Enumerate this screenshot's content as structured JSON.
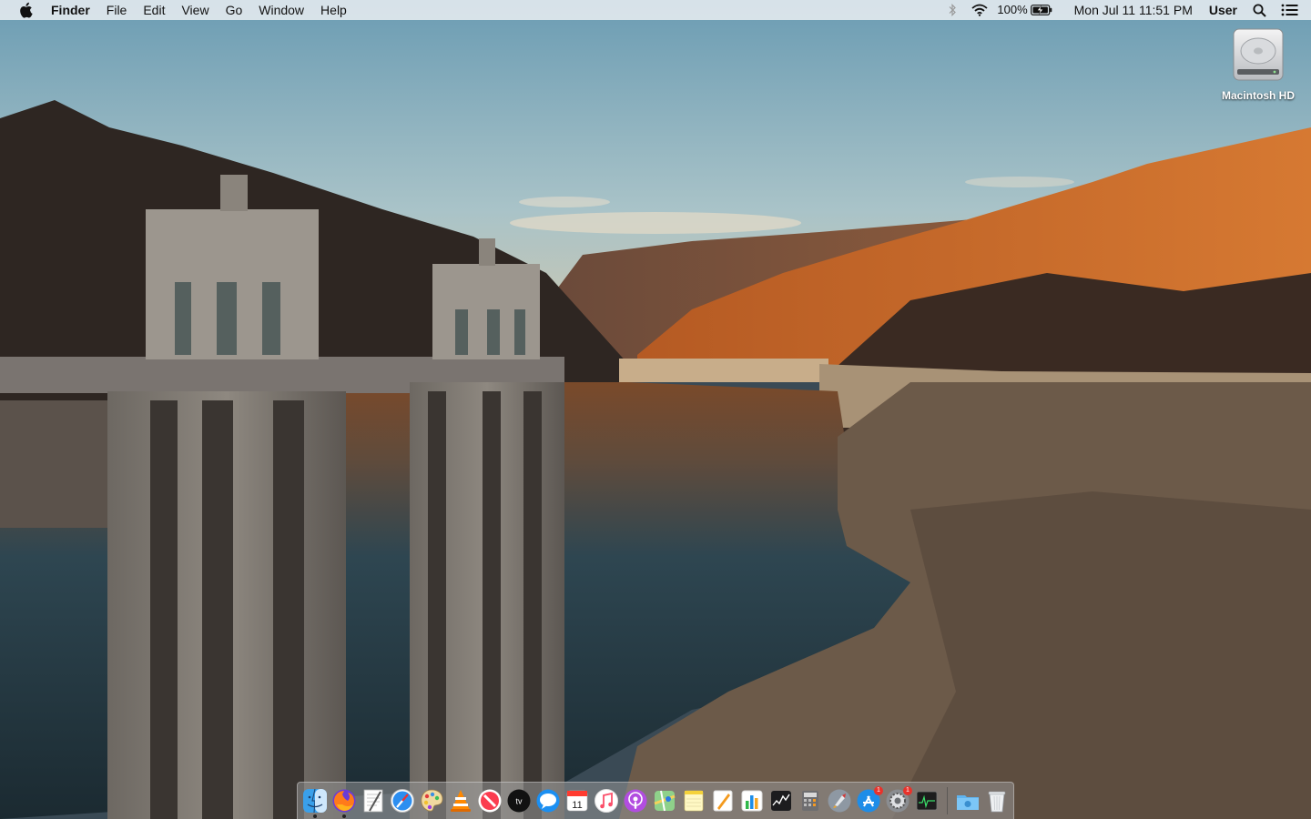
{
  "menubar": {
    "app_name": "Finder",
    "menus": [
      "File",
      "Edit",
      "View",
      "Go",
      "Window",
      "Help"
    ],
    "battery_percent": "100%",
    "clock": "Mon Jul 11  11:51 PM",
    "user": "User"
  },
  "desktop": {
    "icons": [
      {
        "label": "Macintosh HD",
        "icon": "hard-drive-icon"
      }
    ]
  },
  "dock": {
    "apps": [
      {
        "name": "finder",
        "icon": "finder-icon",
        "running": true
      },
      {
        "name": "firefox",
        "icon": "firefox-icon",
        "running": true
      },
      {
        "name": "textedit",
        "icon": "textedit-icon"
      },
      {
        "name": "safari",
        "icon": "safari-icon"
      },
      {
        "name": "color-picker",
        "icon": "palette-icon"
      },
      {
        "name": "vlc",
        "icon": "vlc-icon"
      },
      {
        "name": "news",
        "icon": "news-icon"
      },
      {
        "name": "apple-tv",
        "icon": "tv-icon",
        "label": "tv"
      },
      {
        "name": "messages",
        "icon": "messages-icon"
      },
      {
        "name": "calendar",
        "icon": "calendar-icon",
        "label": "11"
      },
      {
        "name": "music",
        "icon": "music-icon"
      },
      {
        "name": "podcasts",
        "icon": "podcasts-icon"
      },
      {
        "name": "maps",
        "icon": "maps-icon"
      },
      {
        "name": "notes",
        "icon": "notes-icon"
      },
      {
        "name": "pages",
        "icon": "pages-icon"
      },
      {
        "name": "numbers",
        "icon": "numbers-icon"
      },
      {
        "name": "stocks",
        "icon": "stocks-icon"
      },
      {
        "name": "calculator",
        "icon": "calculator-icon"
      },
      {
        "name": "launchpad",
        "icon": "launchpad-icon"
      },
      {
        "name": "app-store",
        "icon": "app-store-icon",
        "badge": "1"
      },
      {
        "name": "system-preferences",
        "icon": "gear-icon",
        "badge": "1"
      },
      {
        "name": "activity-monitor",
        "icon": "terminal-icon"
      },
      {
        "name": "downloads",
        "icon": "folder-icon"
      },
      {
        "name": "trash",
        "icon": "trash-icon"
      }
    ]
  },
  "colors": {
    "sky_top": "#6f9fb5",
    "canyon_orange": "#c0642a",
    "water": "#2f4750",
    "badge": "#e8322b"
  }
}
